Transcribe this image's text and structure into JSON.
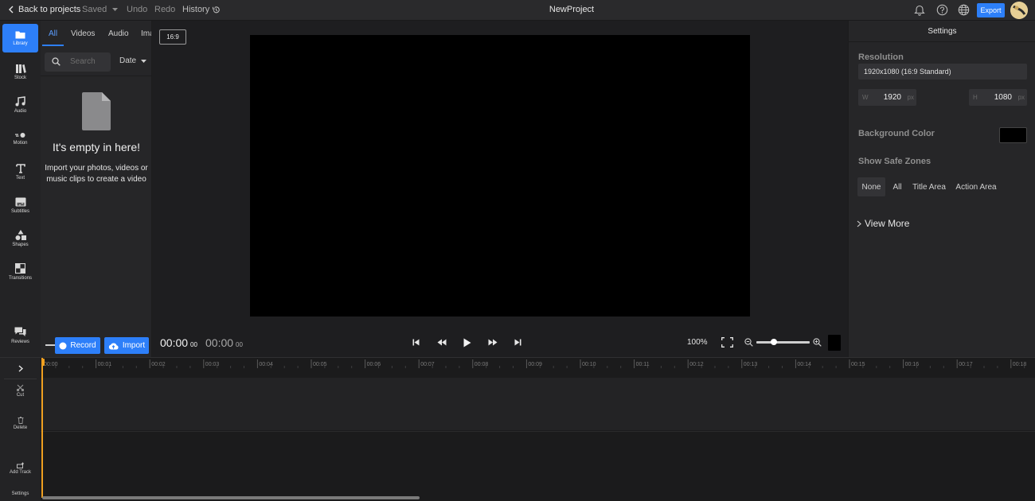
{
  "topbar": {
    "back_label": "Back to projects",
    "saved_label": "Saved",
    "undo_label": "Undo",
    "redo_label": "Redo",
    "history_label": "History",
    "project_name": "NewProject",
    "export_label": "Export",
    "icons": [
      "bell-icon",
      "help-icon",
      "globe-icon"
    ]
  },
  "rail": {
    "items": [
      {
        "label": "Library",
        "icon": "folder-icon",
        "active": true
      },
      {
        "label": "Stock",
        "icon": "books-icon"
      },
      {
        "label": "Audio",
        "icon": "music-icon"
      },
      {
        "label": "Motion",
        "icon": "motion-icon"
      },
      {
        "label": "Text",
        "icon": "text-icon"
      },
      {
        "label": "Subtitles",
        "icon": "subtitles-icon"
      },
      {
        "label": "Shapes",
        "icon": "shapes-icon"
      },
      {
        "label": "Transitions",
        "icon": "transitions-icon"
      },
      {
        "label": "Reviews",
        "icon": "chat-icon"
      }
    ]
  },
  "library": {
    "tabs": [
      "All",
      "Videos",
      "Audio",
      "Ima"
    ],
    "active_tab": "All",
    "search_placeholder": "Search",
    "sort_label": "Date",
    "empty_title": "It's empty in here!",
    "empty_description": "Import your photos, videos or music clips to create a video",
    "record_label": "Record",
    "import_label": "Import"
  },
  "preview": {
    "aspect_ratio": "16:9",
    "current_time": "00:00",
    "current_frames": "00",
    "total_time": "00:00",
    "total_frames": "00",
    "zoom_label": "100%"
  },
  "settings": {
    "title": "Settings",
    "resolution_label": "Resolution",
    "resolution_value": "1920x1080 (16:9 Standard)",
    "width_prefix": "W",
    "width_value": "1920",
    "height_prefix": "H",
    "height_value": "1080",
    "unit": "px",
    "background_label": "Background Color",
    "background_color": "#000000",
    "safe_zones_label": "Show Safe Zones",
    "safe_zone_options": [
      "None",
      "All",
      "Title Area",
      "Action Area"
    ],
    "safe_zone_selected": "None",
    "view_more_label": "View More"
  },
  "timeline": {
    "tools": [
      {
        "label": "Cut",
        "icon": "scissors-icon"
      },
      {
        "label": "Delete",
        "icon": "trash-icon"
      },
      {
        "label": "Add Track",
        "icon": "add-track-icon"
      },
      {
        "label": "Settings",
        "icon": "settings-icon"
      }
    ],
    "ruler_labels": [
      "00:00",
      "00:01",
      "00:02",
      "00:03",
      "00:04",
      "00:05",
      "00:06",
      "00:07",
      "00:08",
      "00:09",
      "00:10",
      "00:11",
      "00:12",
      "00:13",
      "00:14",
      "00:15",
      "00:16",
      "00:17",
      "00:18"
    ]
  },
  "colors": {
    "accent": "#2d7ff9",
    "playhead": "#f0a020",
    "background": "#1e1e20",
    "panel": "#262628"
  }
}
